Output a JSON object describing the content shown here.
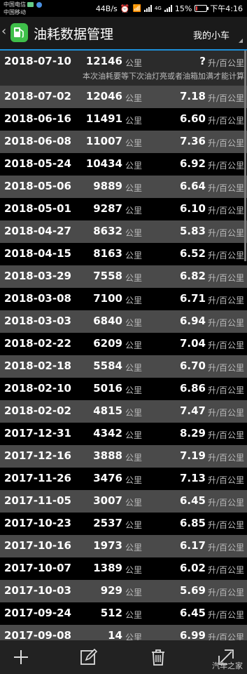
{
  "status": {
    "carrier1": "中国电信",
    "carrier2": "中国移动",
    "speed": "44B/s",
    "network": "4G",
    "battery": "15%",
    "battery_level": 0.15,
    "time": "下午4:16"
  },
  "header": {
    "title": "油耗数据管理",
    "car_selector": "我的小车"
  },
  "unit_odo": "公里",
  "unit_cons": "升/百公里",
  "first_entry": {
    "date": "2018-07-10",
    "odometer": "12146",
    "consumption": "?",
    "note": "本次油耗要等下次油灯亮或者油箱加满才能计算"
  },
  "entries": [
    {
      "date": "2018-07-02",
      "odometer": "12046",
      "consumption": "7.18"
    },
    {
      "date": "2018-06-16",
      "odometer": "11491",
      "consumption": "6.60"
    },
    {
      "date": "2018-06-08",
      "odometer": "11007",
      "consumption": "7.36"
    },
    {
      "date": "2018-05-24",
      "odometer": "10434",
      "consumption": "6.92"
    },
    {
      "date": "2018-05-06",
      "odometer": "9889",
      "consumption": "6.64"
    },
    {
      "date": "2018-05-01",
      "odometer": "9287",
      "consumption": "6.10"
    },
    {
      "date": "2018-04-27",
      "odometer": "8632",
      "consumption": "5.83"
    },
    {
      "date": "2018-04-15",
      "odometer": "8163",
      "consumption": "6.52"
    },
    {
      "date": "2018-03-29",
      "odometer": "7558",
      "consumption": "6.82"
    },
    {
      "date": "2018-03-08",
      "odometer": "7100",
      "consumption": "6.71"
    },
    {
      "date": "2018-03-03",
      "odometer": "6840",
      "consumption": "6.94"
    },
    {
      "date": "2018-02-22",
      "odometer": "6209",
      "consumption": "7.04"
    },
    {
      "date": "2018-02-18",
      "odometer": "5584",
      "consumption": "6.70"
    },
    {
      "date": "2018-02-10",
      "odometer": "5016",
      "consumption": "6.86"
    },
    {
      "date": "2018-02-02",
      "odometer": "4815",
      "consumption": "7.47"
    },
    {
      "date": "2017-12-31",
      "odometer": "4342",
      "consumption": "8.29"
    },
    {
      "date": "2017-12-16",
      "odometer": "3888",
      "consumption": "7.19"
    },
    {
      "date": "2017-11-26",
      "odometer": "3476",
      "consumption": "7.13"
    },
    {
      "date": "2017-11-05",
      "odometer": "3007",
      "consumption": "6.45"
    },
    {
      "date": "2017-10-23",
      "odometer": "2537",
      "consumption": "6.85"
    },
    {
      "date": "2017-10-16",
      "odometer": "1973",
      "consumption": "6.17"
    },
    {
      "date": "2017-10-07",
      "odometer": "1389",
      "consumption": "6.02"
    },
    {
      "date": "2017-10-03",
      "odometer": "929",
      "consumption": "5.69"
    },
    {
      "date": "2017-09-24",
      "odometer": "512",
      "consumption": "6.45"
    },
    {
      "date": "2017-09-08",
      "odometer": "14",
      "consumption": "6.99"
    }
  ],
  "toolbar": {
    "icons": [
      "add-icon",
      "edit-icon",
      "delete-icon",
      "expand-icon"
    ]
  },
  "watermark": "汽车之家",
  "colors": {
    "accent": "#1e8fd8",
    "row_alt": "#4a4a4a",
    "row_base": "#000000",
    "app_icon": "#3fbf4a"
  }
}
